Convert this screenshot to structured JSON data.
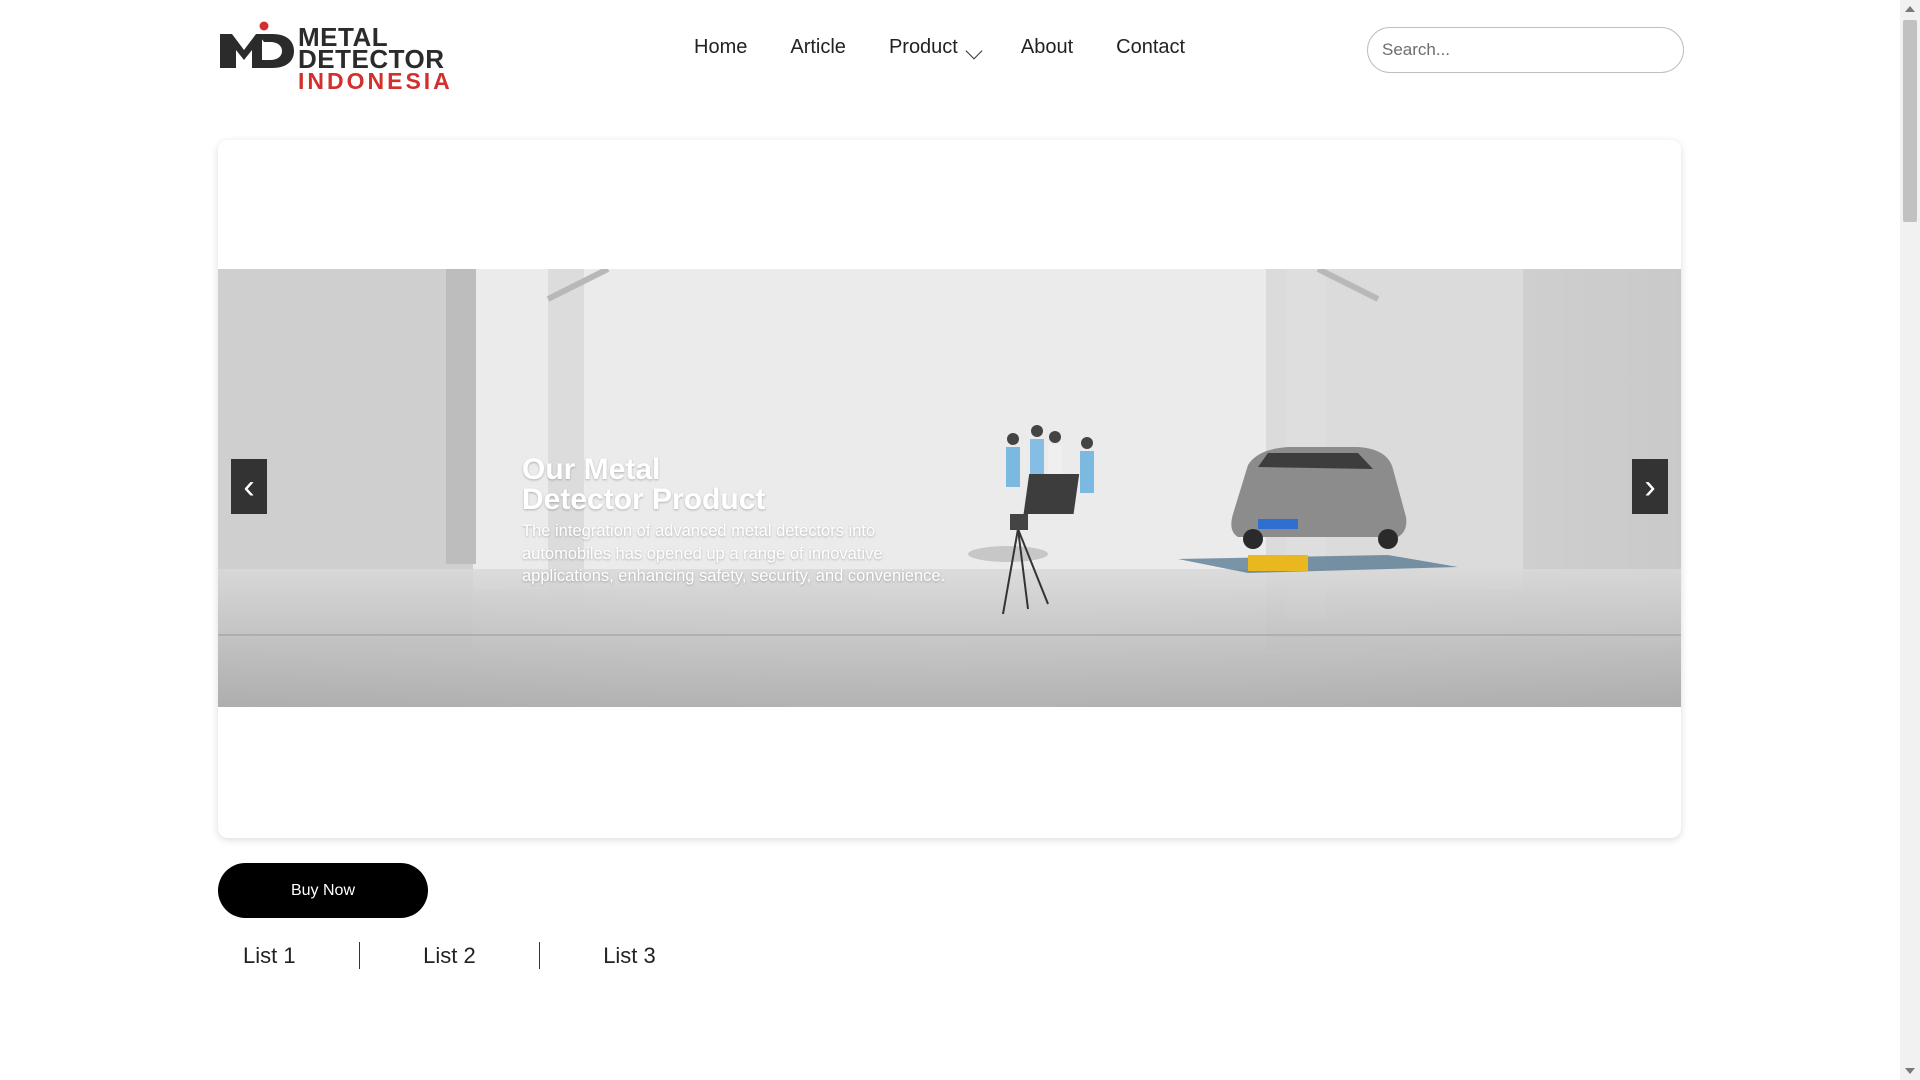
{
  "header": {
    "logo": {
      "mark": "MD",
      "line1": "METAL DETECTOR",
      "line2": "INDONESIA"
    },
    "nav": [
      {
        "label": "Home"
      },
      {
        "label": "Article"
      },
      {
        "label": "Product",
        "has_dropdown": true
      },
      {
        "label": "About"
      },
      {
        "label": "Contact"
      }
    ],
    "search": {
      "placeholder": "Search...",
      "value": ""
    }
  },
  "slider": {
    "title_line1": "Our Metal",
    "title_line2": "Detector Product",
    "description": "The integration of advanced metal detectors into automobiles has opened up a range of innovative applications, enhancing safety, security, and convenience.",
    "prev_label": "‹",
    "next_label": "›"
  },
  "buy_button": {
    "label": "Buy Now"
  },
  "lists": [
    {
      "label": "List 1"
    },
    {
      "label": "List 2"
    },
    {
      "label": "List 3"
    }
  ],
  "colors": {
    "brand_red": "#d32f2f",
    "logo_dark": "#2b2b2b",
    "button_black": "#000000"
  },
  "icons": {
    "dropdown": "chevron-down-icon",
    "prev": "chevron-left-icon",
    "next": "chevron-right-icon"
  }
}
